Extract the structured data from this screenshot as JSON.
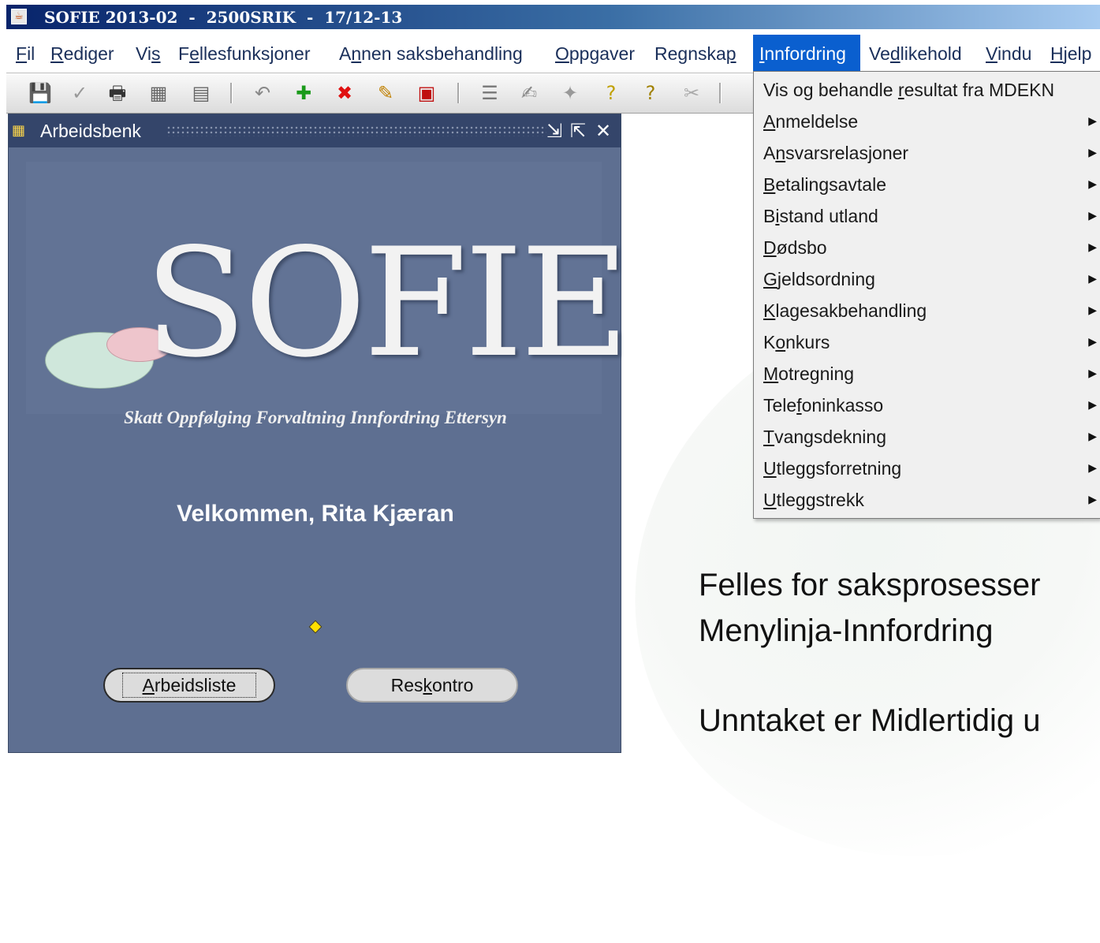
{
  "titlebar": {
    "title": "SOFIE 2013-02  -  2500SRIK  -  17/12-13",
    "icon": "java-app-icon"
  },
  "menubar": {
    "items": [
      {
        "pre": "",
        "u": "F",
        "post": "il"
      },
      {
        "pre": "",
        "u": "R",
        "post": "ediger"
      },
      {
        "pre": "Vi",
        "u": "s",
        "post": ""
      },
      {
        "pre": "F",
        "u": "e",
        "post": "llesfunksjoner"
      },
      {
        "pre": "A",
        "u": "n",
        "post": "nen saksbehandling"
      },
      {
        "pre": "",
        "u": "O",
        "post": "ppgaver"
      },
      {
        "pre": "Regnska",
        "u": "p",
        "post": ""
      },
      {
        "pre": "",
        "u": "I",
        "post": "nnfordring"
      },
      {
        "pre": "Ve",
        "u": "d",
        "post": "likehold"
      },
      {
        "pre": "",
        "u": "V",
        "post": "indu"
      },
      {
        "pre": "",
        "u": "H",
        "post": "jelp"
      }
    ],
    "active_index": 7
  },
  "toolbar": {
    "buttons": [
      "save-icon",
      "check-icon",
      "print-icon",
      "calculator-icon",
      "copy-icon",
      "undo-icon",
      "insert-record-icon",
      "delete-record-icon",
      "clear-icon",
      "query-icon",
      "list-icon",
      "edit-icon",
      "wand-icon",
      "help-icon",
      "help2-icon",
      "tools-icon"
    ]
  },
  "workbench": {
    "title": "Arbeidsbenk",
    "logo": "SOFIE",
    "tagline": "Skatt Oppfølging Forvaltning Innfordring Ettersyn",
    "welcome": "Velkommen, Rita Kjæran",
    "buttons": {
      "arbeidsliste": {
        "pre": "",
        "u": "A",
        "post": "rbeidsliste"
      },
      "reskontro": {
        "pre": "Res",
        "u": "k",
        "post": "ontro"
      }
    }
  },
  "dropdown": {
    "items": [
      {
        "pre": "Vis og behandle ",
        "u": "r",
        "post": "esultat fra MDEKN",
        "submenu": false
      },
      {
        "pre": "",
        "u": "A",
        "post": "nmeldelse",
        "submenu": true
      },
      {
        "pre": "A",
        "u": "n",
        "post": "svarsrelasjoner",
        "submenu": true
      },
      {
        "pre": "",
        "u": "B",
        "post": "etalingsavtale",
        "submenu": true
      },
      {
        "pre": "B",
        "u": "i",
        "post": "stand utland",
        "submenu": true
      },
      {
        "pre": "",
        "u": "D",
        "post": "ødsbo",
        "submenu": true
      },
      {
        "pre": "",
        "u": "G",
        "post": "jeldsordning",
        "submenu": true
      },
      {
        "pre": "",
        "u": "K",
        "post": "lagesakbehandling",
        "submenu": true
      },
      {
        "pre": "K",
        "u": "o",
        "post": "nkurs",
        "submenu": true
      },
      {
        "pre": "",
        "u": "M",
        "post": "otregning",
        "submenu": true
      },
      {
        "pre": "Tele",
        "u": "f",
        "post": "oninkasso",
        "submenu": true
      },
      {
        "pre": "",
        "u": "T",
        "post": "vangsdekning",
        "submenu": true
      },
      {
        "pre": "",
        "u": "U",
        "post": "tleggsforretning",
        "submenu": true
      },
      {
        "pre": "",
        "u": "U",
        "post": "tleggstrekk",
        "submenu": true
      }
    ]
  },
  "notes": {
    "line1": "Felles for saksprosesser",
    "line2": "Menylinja-Innfordring",
    "line3": "Unntaket er Midlertidig u"
  },
  "colors": {
    "menu_active": "#0a5fcf",
    "workbench_bg": "#5e6f91",
    "titlebar_start": "#08246b"
  }
}
